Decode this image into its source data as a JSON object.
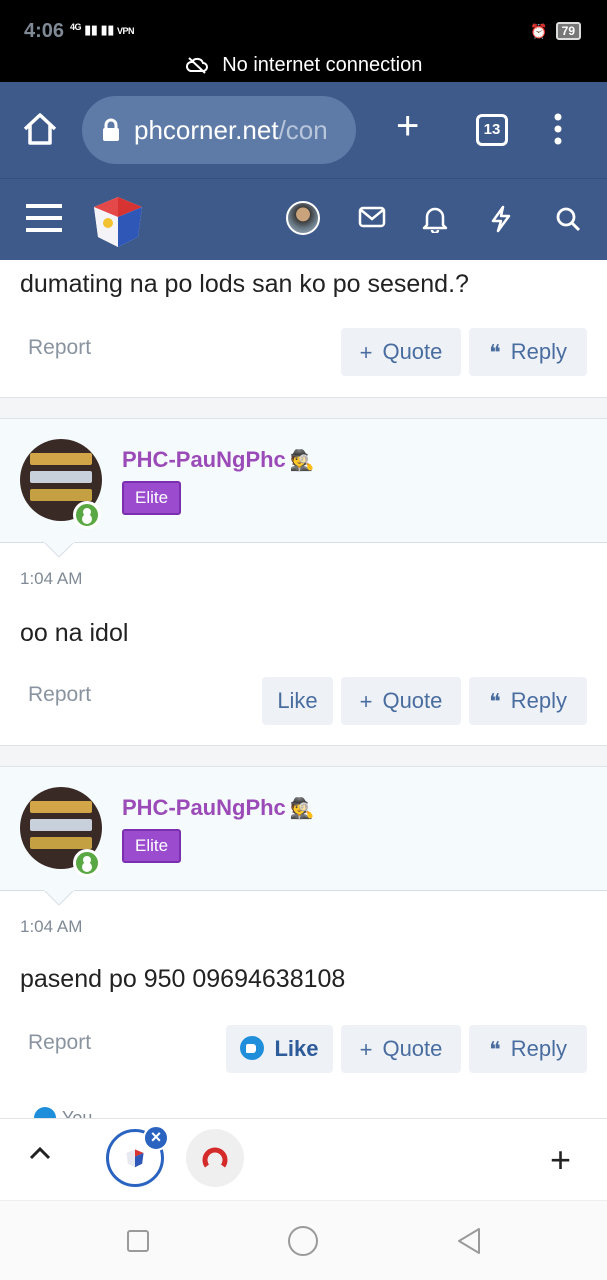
{
  "status_bar": {
    "time": "4:06",
    "network": "4G",
    "vpn": "VPN",
    "battery": "79",
    "notice": "No internet connection"
  },
  "browser": {
    "url_domain": "phcorner.net",
    "url_path": "/con",
    "tab_count": "13"
  },
  "posts": {
    "previous": {
      "text": "dumating na po lods san ko po sesend.?",
      "report": "Report",
      "quote": "Quote",
      "reply": "Reply"
    },
    "post1": {
      "username": "PHC-PauNgPhc",
      "badge": "Elite",
      "time": "1:04 AM",
      "text": "oo na idol",
      "report": "Report",
      "like": "Like",
      "quote": "Quote",
      "reply": "Reply"
    },
    "post2": {
      "username": "PHC-PauNgPhc",
      "badge": "Elite",
      "time": "1:04 AM",
      "text": "pasend po 950 09694638108",
      "report": "Report",
      "like": "Like",
      "like_state": "liked",
      "quote": "Quote",
      "reply": "Reply",
      "reactions_partial": "You"
    }
  },
  "colors": {
    "header_bg": "#3d5a8a",
    "username": "#9b4bb8",
    "badge": "#9b4bce",
    "button_text": "#4a6da0",
    "online": "#5aa843"
  },
  "icons": [
    "home-icon",
    "lock-icon",
    "plus-icon",
    "tabs-icon",
    "more-icon",
    "menu-icon",
    "site-logo",
    "user-avatar",
    "mail-icon",
    "bell-icon",
    "bolt-icon",
    "search-icon",
    "quote-plus-icon",
    "reply-quote-icon",
    "like-thumb-icon",
    "chevron-up-icon",
    "close-icon"
  ]
}
